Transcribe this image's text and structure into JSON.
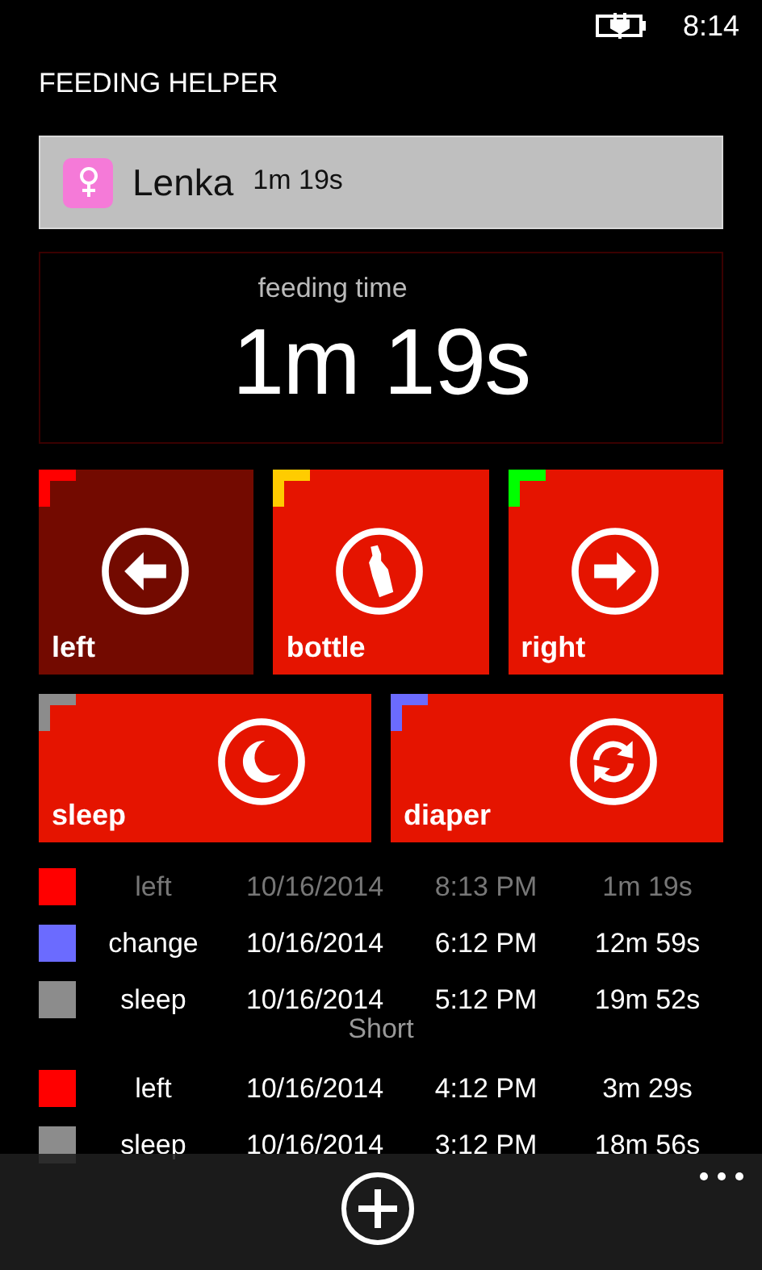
{
  "status_bar": {
    "time": "8:14"
  },
  "app_title": "FEEDING HELPER",
  "profile": {
    "name": "Lenka",
    "elapsed": "1m 19s",
    "color": "#f57ad8"
  },
  "timer": {
    "label": "feeding time",
    "value": "1m 19s"
  },
  "tiles": [
    {
      "label": "left",
      "kind": "left",
      "selected": true,
      "color": "#ff0000"
    },
    {
      "label": "bottle",
      "kind": "bottle",
      "selected": false,
      "color": "#ffcc00"
    },
    {
      "label": "right",
      "kind": "right",
      "selected": false,
      "color": "#00ff00"
    },
    {
      "label": "sleep",
      "kind": "sleep",
      "selected": false,
      "color": "#8c8c8c"
    },
    {
      "label": "diaper",
      "kind": "diaper",
      "selected": false,
      "color": "#6b6bff"
    }
  ],
  "entries": [
    {
      "kind": "entry",
      "type": "left",
      "date": "10/16/2014",
      "time": "8:13 PM",
      "duration": "1m 19s",
      "color": "#ff0000",
      "in_progress": true
    },
    {
      "kind": "entry",
      "type": "change",
      "date": "10/16/2014",
      "time": "6:12 PM",
      "duration": "12m 59s",
      "color": "#6b6bff",
      "in_progress": false
    },
    {
      "kind": "entry",
      "type": "sleep",
      "date": "10/16/2014",
      "time": "5:12 PM",
      "duration": "19m 52s",
      "color": "#8c8c8c",
      "in_progress": false
    },
    {
      "kind": "note",
      "text": "Short"
    },
    {
      "kind": "entry",
      "type": "left",
      "date": "10/16/2014",
      "time": "4:12 PM",
      "duration": "3m 29s",
      "color": "#ff0000",
      "in_progress": false
    },
    {
      "kind": "entry",
      "type": "sleep",
      "date": "10/16/2014",
      "time": "3:12 PM",
      "duration": "18m 56s",
      "color": "#8c8c8c",
      "in_progress": false
    }
  ]
}
